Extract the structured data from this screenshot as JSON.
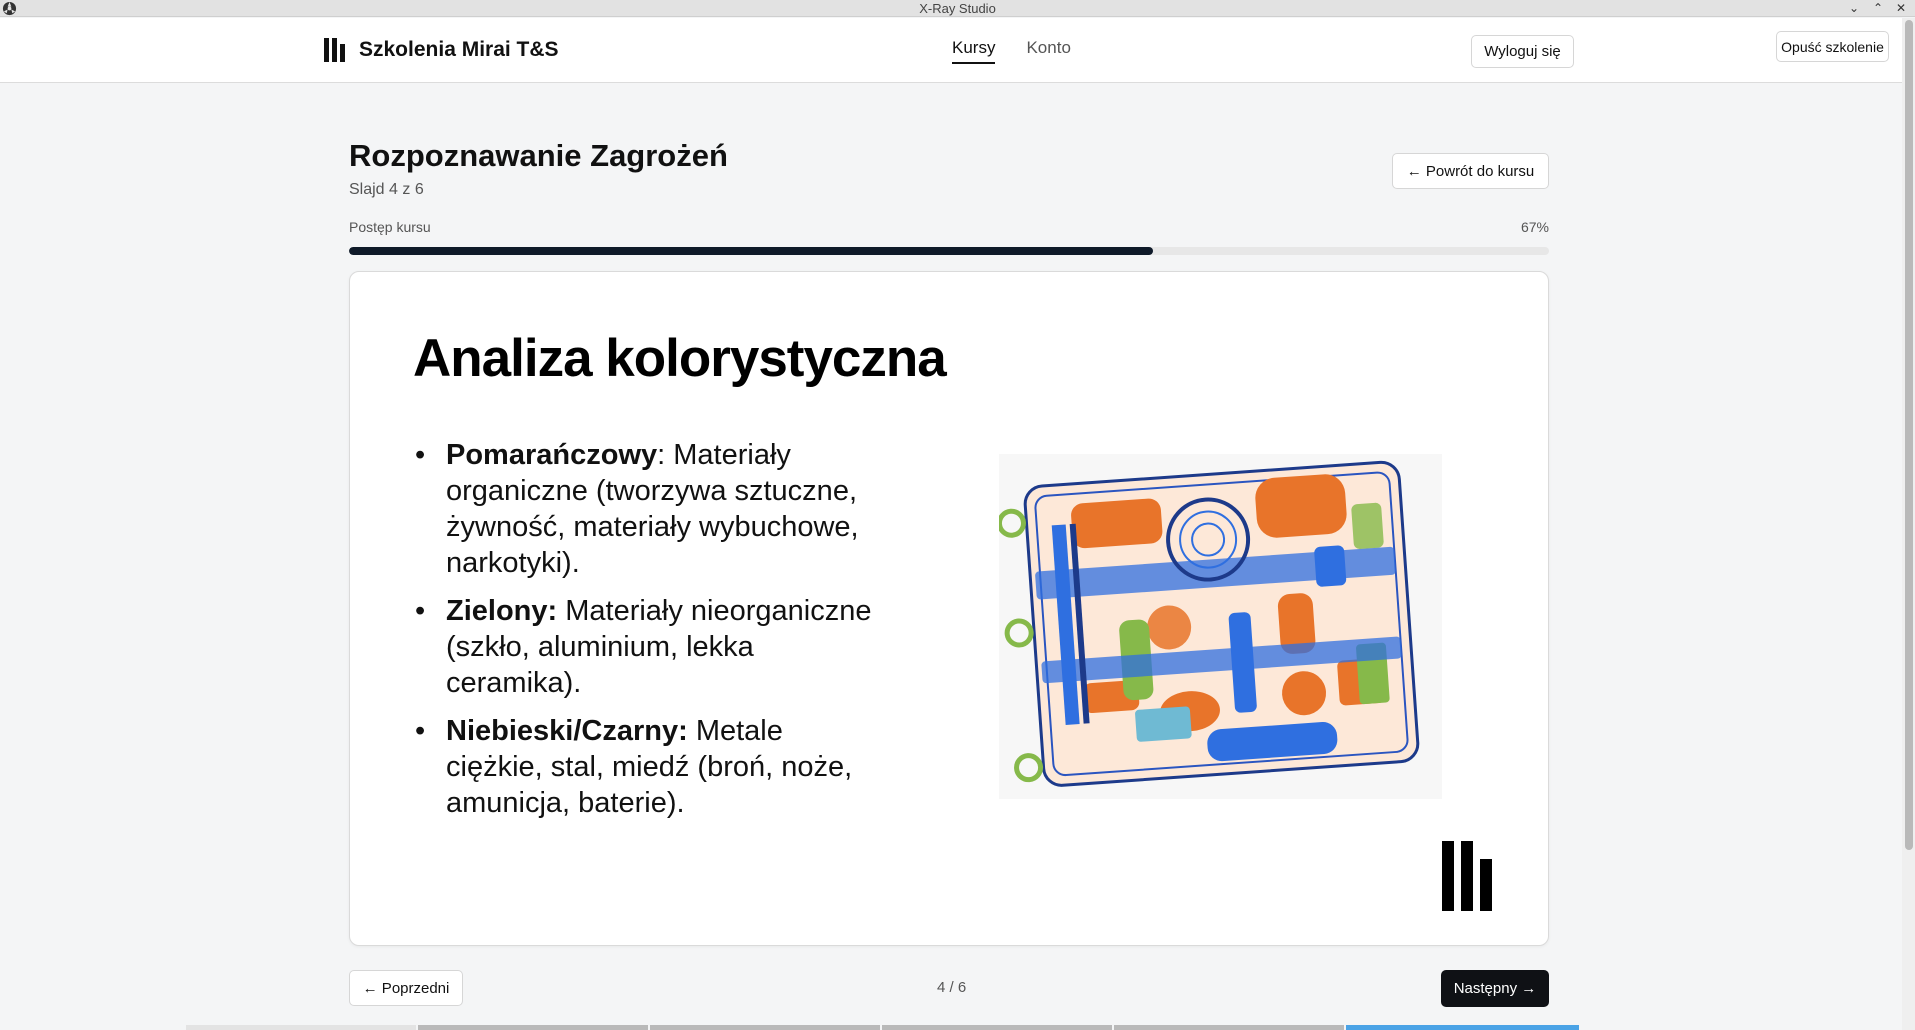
{
  "window": {
    "title": "X-Ray Studio"
  },
  "header": {
    "brand": "Szkolenia Mirai T&S",
    "nav": [
      {
        "label": "Kursy",
        "active": true
      },
      {
        "label": "Konto",
        "active": false
      }
    ],
    "logout_label": "Wyloguj się",
    "exit_label": "Opuść szkolenie"
  },
  "lesson": {
    "title": "Rozpoznawanie Zagrożeń",
    "slide_counter": "Slajd 4 z 6",
    "back_label": "← Powrót do kursu",
    "progress_label": "Postęp kursu",
    "progress_text": "67%",
    "progress_fraction": 0.67
  },
  "slide": {
    "heading": "Analiza kolorystyczna",
    "bullets": [
      {
        "term": "Pomarańczowy",
        "text": ": Materiały organiczne (tworzywa sztuczne, żywność, materiały wybuchowe, narkotyki)."
      },
      {
        "term": "Zielony:",
        "text": " Materiały nieorganiczne (szkło, aluminium, lekka ceramika)."
      },
      {
        "term": "Niebieski/Czarny:",
        "text": " Metale ciężkie, stal, miedź (broń, noże, amunicja, baterie)."
      }
    ]
  },
  "footer": {
    "prev_label": "← Poprzedni",
    "pager": "4 / 6",
    "next_label": "Następny →"
  },
  "colors": {
    "organic": "#e8742a",
    "inorganic": "#86b94a",
    "metal": "#2f6fe0",
    "accent_dark": "#0f1a29"
  }
}
